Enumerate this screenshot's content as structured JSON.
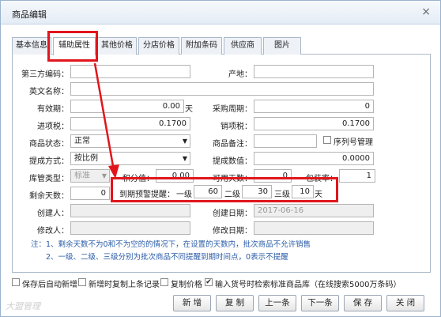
{
  "window": {
    "title": "商品编辑",
    "close": "×"
  },
  "tabs": [
    "基本信息",
    "辅助属性",
    "其他价格",
    "分店价格",
    "附加条码",
    "供应商",
    "图片"
  ],
  "form": {
    "third_code": {
      "label": "第三方编码：",
      "value": ""
    },
    "origin": {
      "label": "产地：",
      "value": ""
    },
    "english_name": {
      "label": "英文名称：",
      "value": ""
    },
    "validity": {
      "label": "有效期：",
      "value": "0.00",
      "unit": "天"
    },
    "purchase_cycle": {
      "label": "采购周期：",
      "value": "0"
    },
    "input_tax": {
      "label": "进项税：",
      "value": "0.1700"
    },
    "output_tax": {
      "label": "销项税：",
      "value": "0.1700"
    },
    "status": {
      "label": "商品状态：",
      "value": "正常"
    },
    "remark": {
      "label": "商品备注：",
      "value": ""
    },
    "serial_mgmt": {
      "label": "序列号管理",
      "checked": false
    },
    "commission_mode": {
      "label": "提成方式：",
      "value": "按比例"
    },
    "commission_value": {
      "label": "提成数值：",
      "value": "0.0000"
    },
    "stock_type": {
      "label": "库管类型：",
      "value": "标准"
    },
    "points": {
      "label": "积分值：",
      "value": "0.00"
    },
    "available_days": {
      "label": "可用天数：",
      "value": "0"
    },
    "pack_rate": {
      "label": "包装率：",
      "value": "1"
    },
    "remaining_days": {
      "label": "剩余天数：",
      "value": "0"
    },
    "expiry_alert": {
      "label": "到期预警提醒：",
      "level1_label": "一级",
      "level1": "60",
      "level2_label": "二级",
      "level2": "30",
      "level3_label": "三级",
      "level3": "10",
      "unit": "天"
    },
    "creator": {
      "label": "创建人：",
      "value": ""
    },
    "created_date": {
      "label": "创建日期：",
      "value": "2017-06-16"
    },
    "modifier": {
      "label": "修改人：",
      "value": ""
    },
    "modified_date": {
      "label": "修改日期：",
      "value": ""
    }
  },
  "notes": [
    "注：1、剩余天数不为0和不为空的的情况下，在设置的天数内，批次商品不允许销售",
    "2、一级、二级、三级分别为批次商品不同提醒到期时间点，0表示不提醒"
  ],
  "options": [
    {
      "label": "保存后自动新增",
      "checked": false
    },
    {
      "label": "新增时复制上条记录",
      "checked": false
    },
    {
      "label": "复制价格",
      "checked": false
    },
    {
      "label": "输入货号时检索标准商品库（在线搜索5000万条码）",
      "checked": true
    }
  ],
  "buttons": [
    "新 增",
    "复 制",
    "上一条",
    "下一条",
    "保 存",
    "关 闭"
  ],
  "watermark": "大盟管理",
  "colors": {
    "highlight": "#e0161c",
    "note": "#2b5ca8",
    "arrow": "#e0161c"
  }
}
